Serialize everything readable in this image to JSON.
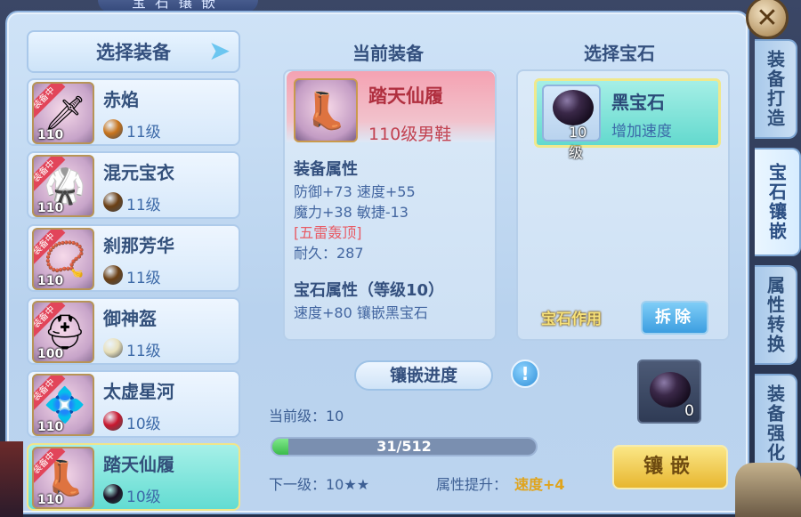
{
  "window_title": "宝石镶嵌",
  "close_label": "✕",
  "side_tabs": [
    {
      "label": "装备打造"
    },
    {
      "label": "宝石镶嵌"
    },
    {
      "label": "属性转换"
    },
    {
      "label": "装备强化"
    }
  ],
  "equip_list": {
    "header": "选择装备",
    "ribbon": "装备中",
    "items": [
      {
        "name": "赤焰",
        "level": "110",
        "gem_level": "11级",
        "gem_color": "#c8741c",
        "art": "🗡"
      },
      {
        "name": "混元宝衣",
        "level": "110",
        "gem_level": "11级",
        "gem_color": "#6b3f14",
        "art": "🥋"
      },
      {
        "name": "刹那芳华",
        "level": "110",
        "gem_level": "11级",
        "gem_color": "#6b3f14",
        "art": "📿"
      },
      {
        "name": "御神盔",
        "level": "100",
        "gem_level": "11级",
        "gem_color": "#e8e0bb",
        "art": "⛑"
      },
      {
        "name": "太虚星河",
        "level": "110",
        "gem_level": "10级",
        "gem_color": "#c9182f",
        "art": "💠"
      },
      {
        "name": "踏天仙履",
        "level": "110",
        "gem_level": "10级",
        "gem_color": "#1a0f22",
        "art": "👢"
      }
    ]
  },
  "current": {
    "title": "当前装备",
    "name": "踏天仙履",
    "type": "110级男鞋",
    "attr_title": "装备属性",
    "attr_lines": [
      "防御+73 速度+55",
      "魔力+38 敏捷-13"
    ],
    "special": "[五雷轰顶]",
    "durability": "耐久：287",
    "gem_attr_title": "宝石属性（等级10）",
    "gem_attr_line": "速度+80 镶嵌黑宝石"
  },
  "gem_select": {
    "title": "选择宝石",
    "gem_name": "黑宝石",
    "gem_level": "10级",
    "gem_desc": "增加速度",
    "effect_label": "宝石作用",
    "remove_label": "拆除"
  },
  "progress": {
    "title": "镶嵌进度",
    "current_level": "当前级：10",
    "value": 31,
    "max": 512,
    "text": "31/512",
    "next_level": "下一级：10★★",
    "attr_up_label": "属性提升：",
    "attr_up_value": "速度+4"
  },
  "slot": {
    "count": "0"
  },
  "inlay_label": "镶嵌"
}
